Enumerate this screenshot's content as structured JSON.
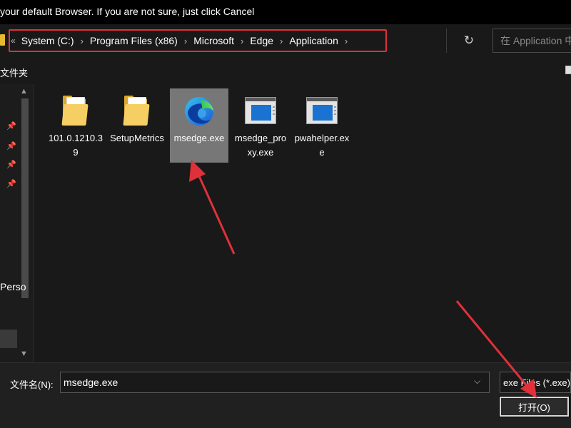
{
  "dialog": {
    "instruction_text": "your default Browser. If you are not sure, just click Cancel"
  },
  "address_bar": {
    "leading_chevron": "«",
    "breadcrumbs": [
      "System (C:)",
      "Program Files (x86)",
      "Microsoft",
      "Edge",
      "Application"
    ],
    "separator": "›",
    "refresh_icon": "refresh-icon",
    "search_placeholder": "在 Application 中搜索",
    "highlight_color": "#e0303a"
  },
  "toolbar": {
    "new_folder_label": "文件夹"
  },
  "navigation_pane": {
    "partial_item_label": "Perso"
  },
  "files": [
    {
      "name": "101.0.1210.39",
      "type": "folder"
    },
    {
      "name": "SetupMetrics",
      "type": "folder"
    },
    {
      "name": "msedge.exe",
      "type": "edge-app",
      "selected": true
    },
    {
      "name": "msedge_proxy.exe",
      "type": "app"
    },
    {
      "name": "pwahelper.exe",
      "type": "app"
    }
  ],
  "bottom_bar": {
    "filename_label": "文件名(N):",
    "filename_value": "msedge.exe",
    "file_type_filter": "exe Files (*.exe)",
    "open_button_label": "打开(O)"
  },
  "annotations": {
    "arrow_color": "#e0303a"
  }
}
